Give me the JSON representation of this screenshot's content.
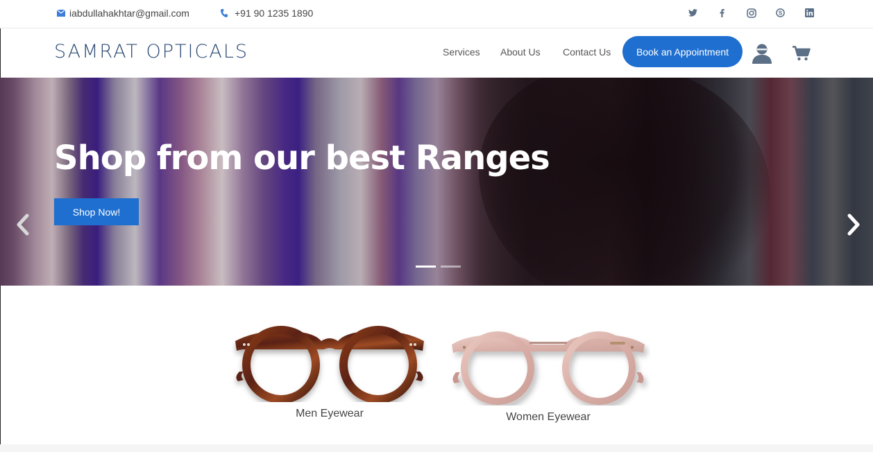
{
  "topbar": {
    "email": "iabdullahakhtar@gmail.com",
    "phone": "+91 90 1235 1890",
    "socials": [
      "twitter-icon",
      "facebook-icon",
      "instagram-icon",
      "skype-icon",
      "linkedin-icon"
    ]
  },
  "header": {
    "logo": "SAMRAT OPTICALS",
    "nav": {
      "services": "Services",
      "about": "About Us",
      "contact": "Contact Us"
    },
    "book_button": "Book an Appointment"
  },
  "hero": {
    "title": "Shop from our best Ranges",
    "button": "Shop Now!",
    "slides": 2,
    "active_slide": 1
  },
  "products": [
    {
      "label": "Men Eyewear"
    },
    {
      "label": "Women Eyewear"
    }
  ],
  "colors": {
    "primary": "#1f6fd0",
    "logo": "#2c4a73",
    "icon": "#5b6f86"
  }
}
